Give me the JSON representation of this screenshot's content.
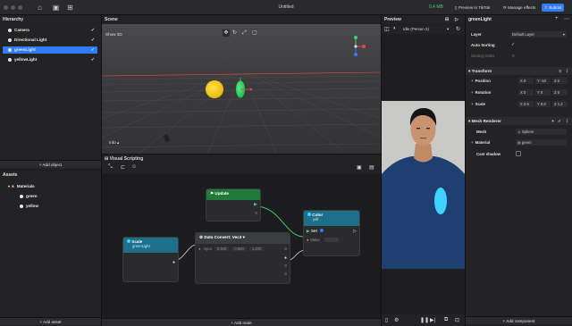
{
  "titlebar": {
    "title": "Untitled",
    "memory": "0.4 MB",
    "preview_label": "Preview in TikTok",
    "manage_label": "Manage effects",
    "submit_label": "Submit"
  },
  "hierarchy": {
    "title": "Hierarchy",
    "items": [
      {
        "label": "Camera"
      },
      {
        "label": "Directional Light"
      },
      {
        "label": "greenLight",
        "selected": true
      },
      {
        "label": "yellowLight"
      }
    ],
    "add_object": "+ Add object"
  },
  "assets": {
    "title": "Assets",
    "folder": "Materials",
    "items": [
      "green",
      "yellow"
    ],
    "add_asset": "+ Add asset"
  },
  "scene": {
    "title": "Scene",
    "mode": "Show 3D",
    "info": "Info"
  },
  "visual_scripting": {
    "title": "Visual Scripting",
    "add_node": "+ Add node",
    "nodes": {
      "update": {
        "title": "Update"
      },
      "color": {
        "title": "Color",
        "subtitle": "yell",
        "set_label": "Set",
        "value_label": "Value"
      },
      "scale": {
        "title": "Scale",
        "subtitle": "greenLight"
      },
      "convert": {
        "title": "Data Convert: Vec3",
        "input_label": "Input",
        "x": "0.500",
        "y": "0.800",
        "z": "1.200"
      }
    }
  },
  "preview": {
    "title": "Preview",
    "mode": "Idle (Person 2)"
  },
  "inspector": {
    "object_name": "greenLight",
    "layer_label": "Layer",
    "layer_value": "Default Layer",
    "auto_sorting_label": "Auto Sorting",
    "sorting_order_label": "Sorting Order",
    "sorting_order_value": "0",
    "transform": {
      "title": "Transform",
      "position_label": "Position",
      "position": [
        "0",
        "-10",
        "0"
      ],
      "rotation_label": "Rotation",
      "rotation": [
        "0",
        "0",
        "0"
      ],
      "scale_label": "Scale",
      "scale": [
        "0.5",
        "0.8",
        "1.2"
      ]
    },
    "mesh_renderer": {
      "title": "Mesh Renderer",
      "mesh_label": "Mesh",
      "mesh_value": "Sphere",
      "material_label": "Material",
      "material_value": "green",
      "cast_shadow_label": "Cast shadow"
    },
    "add_component": "+ Add component"
  },
  "colors": {
    "accent": "#2f7cf6",
    "green_node": "#1f7a3a",
    "cyan_node": "#1d6f8a",
    "yellow_sphere": "#f4c20d",
    "green_sphere": "#2ad36a",
    "cyan_overlay": "#3fd1ff"
  }
}
